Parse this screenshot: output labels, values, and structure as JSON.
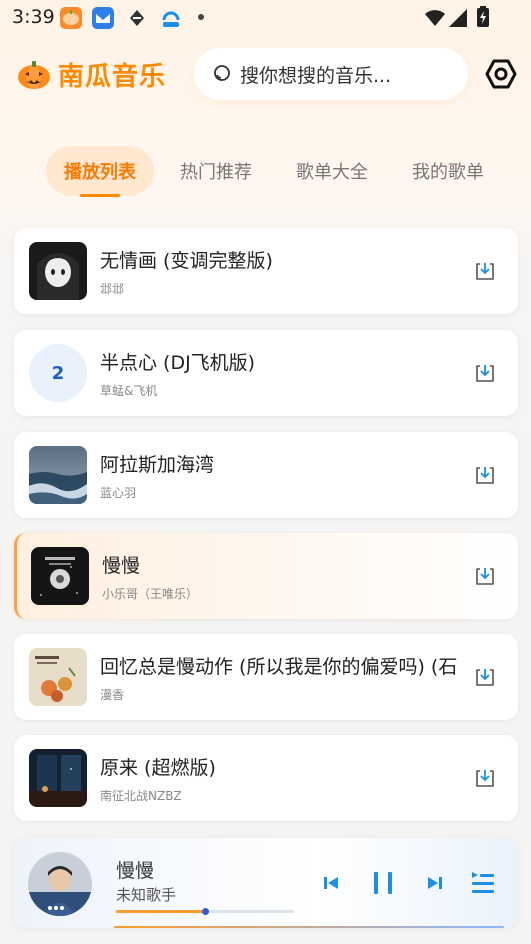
{
  "status_bar": {
    "time": "3:39"
  },
  "app": {
    "name": "南瓜音乐"
  },
  "search": {
    "placeholder": "搜你想搜的音乐..."
  },
  "tabs": [
    {
      "label": "播放列表",
      "active": true
    },
    {
      "label": "热门推荐",
      "active": false
    },
    {
      "label": "歌单大全",
      "active": false
    },
    {
      "label": "我的歌单",
      "active": false
    }
  ],
  "songs": [
    {
      "title": "无情画 (变调完整版)",
      "artist": "邶邶",
      "cover": "anime-girl-cover"
    },
    {
      "title": "半点心 (DJ飞机版)",
      "artist": "草蜢&飞机",
      "cover_number": "2"
    },
    {
      "title": "阿拉斯加海湾",
      "artist": "蓝心羽",
      "cover": "ocean-cover"
    },
    {
      "title": "慢慢",
      "artist": "小乐哥（王唯乐）",
      "cover": "dark-cover",
      "active": true
    },
    {
      "title": "回忆总是慢动作 (所以我是你的偏爱吗) (石",
      "artist": "漫香",
      "cover": "flowers-cover"
    },
    {
      "title": "原来 (超燃版)",
      "artist": "南征北战NZBZ",
      "cover": "night-window-cover"
    }
  ],
  "player": {
    "title": "慢慢",
    "artist": "未知歌手",
    "progress": 0.5,
    "controls": [
      "previous-icon",
      "pause-icon",
      "next-icon",
      "playlist-icon"
    ]
  },
  "colors": {
    "accent": "#ff8a00",
    "player_blue": "#1a8fe8"
  }
}
